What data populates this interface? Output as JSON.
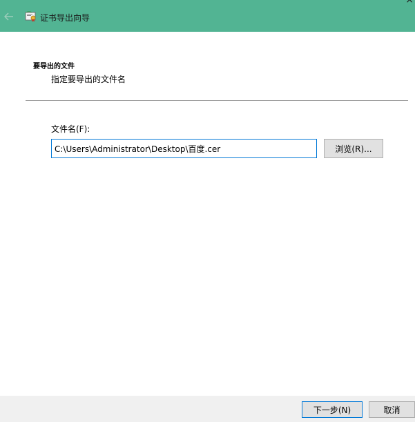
{
  "window": {
    "title": "证书导出向导",
    "close_glyph": "×",
    "back_icon": "arrow-left-icon",
    "app_icon": "certificate-icon"
  },
  "page": {
    "heading": "要导出的文件",
    "description": "指定要导出的文件名"
  },
  "file": {
    "label": "文件名(F):",
    "value": "C:\\Users\\Administrator\\Desktop\\百度.cer",
    "browse_label": "浏览(R)..."
  },
  "footer": {
    "next_label": "下一步(N)",
    "cancel_label": "取消"
  },
  "colors": {
    "titlebar": "#52b493",
    "focus_border": "#0078d7",
    "button_bg": "#e1e1e1",
    "footer_bg": "#f0f0f0"
  }
}
